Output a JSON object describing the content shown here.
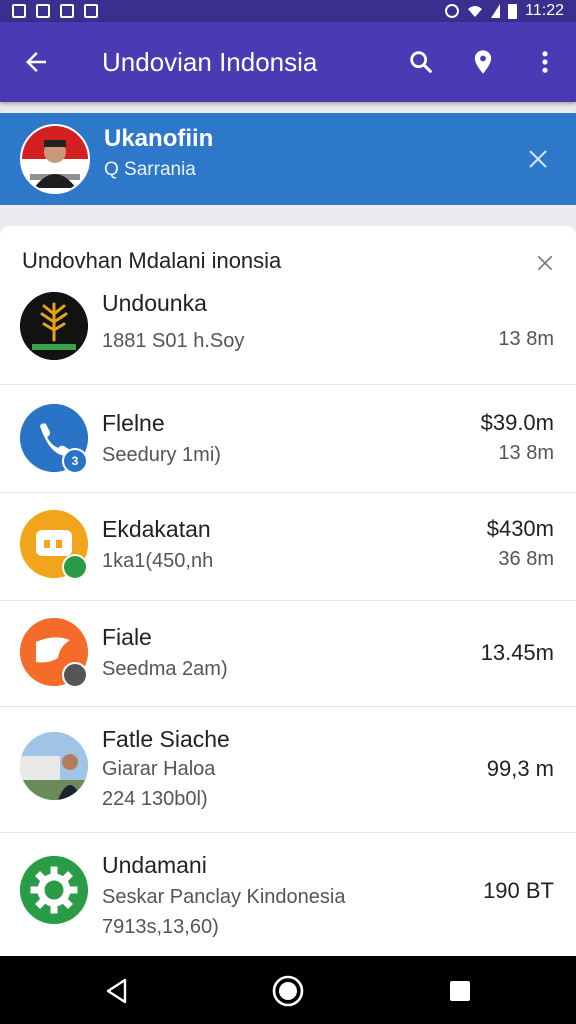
{
  "status_bar": {
    "time": "11:22"
  },
  "app_bar": {
    "title": "Undovian Indonsia"
  },
  "banner": {
    "title": "Ukanofiin",
    "subtitle": "Q Sarrania"
  },
  "sheet": {
    "title": "Undovhan Mdalani inonsia",
    "items": [
      {
        "name": "Undounka",
        "sub": "1881 S01 h.Soy",
        "meta": "13 8m"
      },
      {
        "name": "Flelne",
        "sub": "Seedury 1mi)",
        "price": "$39.0m",
        "meta": "13 8m",
        "badge": "3"
      },
      {
        "name": "Ekdakatan",
        "sub": "1ka1(450,nh",
        "price": "$430m",
        "meta": "36 8m"
      },
      {
        "name": "Fiale",
        "sub": "Seedma 2am)",
        "price": "13.45m"
      },
      {
        "name": "Fatle Siache",
        "sub": "Giarar Haloa",
        "sub2": "224 130b0l)",
        "price": "99,3 m"
      },
      {
        "name": "Undamani",
        "sub": "Seskar Panclay Kindonesia",
        "sub2": "7913s,13,60)",
        "price": "190 BT"
      }
    ]
  },
  "colors": {
    "app_bar": "#4a3bb4",
    "banner": "#2e78c9",
    "phone": "#2a74c8",
    "orange": "#f2a51a",
    "orange_red": "#f46b2a",
    "green": "#2a9c48"
  }
}
